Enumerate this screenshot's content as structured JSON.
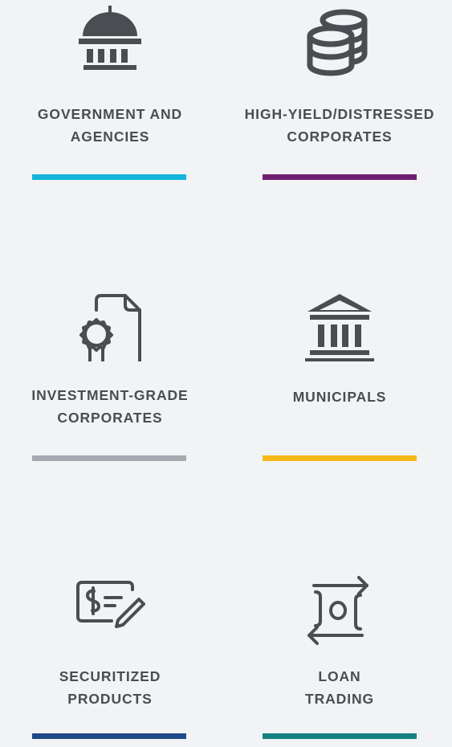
{
  "tiles": [
    {
      "label": "GOVERNMENT AND\nAGENCIES",
      "icon": "capitol-dome-icon",
      "bar_color": "#14b5d9"
    },
    {
      "label": "HIGH-YIELD/DISTRESSED\nCORPORATES",
      "icon": "coin-stacks-icon",
      "bar_color": "#6e1f72"
    },
    {
      "label": "INVESTMENT-GRADE\nCORPORATES",
      "icon": "certificate-document-icon",
      "bar_color": "#a5abb1"
    },
    {
      "label": "MUNICIPALS",
      "icon": "civic-building-icon",
      "bar_color": "#f7b916"
    },
    {
      "label": "SECURITIZED\nPRODUCTS",
      "icon": "signed-bill-icon",
      "bar_color": "#1f4a87"
    },
    {
      "label": "LOAN\nTRADING",
      "icon": "money-exchange-icon",
      "bar_color": "#14807f"
    }
  ],
  "colors": {
    "background": "#f2f3f5",
    "text": "#4a4d51",
    "icon": "#4a4d51"
  }
}
